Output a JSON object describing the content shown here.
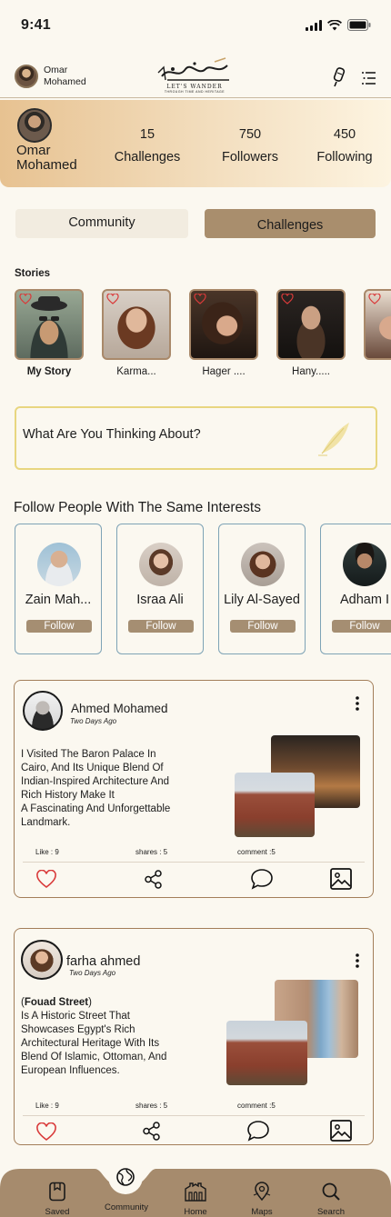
{
  "status_bar": {
    "time": "9:41"
  },
  "header": {
    "user_name": "Omar\nMohamed",
    "logo_text": "LET'S WANDER",
    "logo_subtext": "THROUGH TIME AND HERITAGE"
  },
  "profile": {
    "name_line1": "Omar",
    "name_line2": "Mohamed",
    "stats": [
      {
        "value": "15",
        "label": "Challenges"
      },
      {
        "value": "750",
        "label": "Followers"
      },
      {
        "value": "450",
        "label": "Following"
      }
    ]
  },
  "tabs": {
    "community": "Community",
    "challenges": "Challenges"
  },
  "stories": {
    "title": "Stories",
    "items": [
      {
        "label": "My Story"
      },
      {
        "label": "Karma..."
      },
      {
        "label": "Hager ...."
      },
      {
        "label": "Hany....."
      },
      {
        "label": ""
      }
    ]
  },
  "composer": {
    "placeholder": "What Are You Thinking About?"
  },
  "suggestions": {
    "title": "Follow People With The Same Interests",
    "people": [
      {
        "name": "Zain Mah...",
        "button": "Follow"
      },
      {
        "name": "Israa Ali",
        "button": "Follow"
      },
      {
        "name": "Lily Al-Sayed",
        "button": "Follow"
      },
      {
        "name": "Adham I",
        "button": "Follow"
      }
    ]
  },
  "posts": [
    {
      "author": "Ahmed Mohamed",
      "time": "Two Days Ago",
      "body": "I Visited The Baron Palace In\nCairo, And Its Unique Blend Of\nIndian-Inspired Architecture And\nRich History Make It\n A Fascinating And Unforgettable\nLandmark.",
      "likes": "Like : 9",
      "shares": "shares : 5",
      "comments": "comment  :5"
    },
    {
      "author": "farha ahmed",
      "time": "Two Days Ago",
      "body_title": "Fouad Street",
      "body": " Is A Historic Street That\nShowcases Egypt's Rich\nArchitectural Heritage With Its\nBlend Of Islamic, Ottoman, And\nEuropean Influences.",
      "likes": "Like : 9",
      "shares": "shares : 5",
      "comments": "comment  :5"
    }
  ],
  "bottom_nav": [
    {
      "label": "Saved",
      "icon": "bookmark-icon"
    },
    {
      "label": "Community",
      "icon": "globe-icon"
    },
    {
      "label": "Home",
      "icon": "building-icon"
    },
    {
      "label": "Maps",
      "icon": "map-pin-icon"
    },
    {
      "label": "Search",
      "icon": "search-icon"
    }
  ],
  "colors": {
    "background": "#fbf8f0",
    "accent_brown": "#a98e6d",
    "nav_brown": "#a68b6d",
    "card_border_blue": "#7ea3b6",
    "heart_red": "#d93a3a"
  }
}
